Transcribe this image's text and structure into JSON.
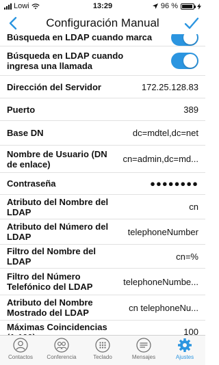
{
  "status": {
    "carrier": "Lowi",
    "time": "13:29",
    "battery_text": "96 %",
    "battery_level": 0.96
  },
  "nav": {
    "title": "Configuración Manual",
    "back_icon": "chevron-left-icon",
    "done_icon": "checkmark-icon"
  },
  "rows": [
    {
      "label": "Búsqueda en LDAP cuando marca",
      "type": "toggle",
      "on": true
    },
    {
      "label": "Búsqueda en LDAP cuando ingresa una llamada",
      "type": "toggle",
      "on": true
    },
    {
      "label": "Dirección del Servidor",
      "value": "172.25.128.83"
    },
    {
      "label": "Puerto",
      "value": "389"
    },
    {
      "label": "Base DN",
      "value": "dc=mdtel,dc=net"
    },
    {
      "label": "Nombre de Usuario (DN de enlace)",
      "value": "cn=admin,dc=md..."
    },
    {
      "label": "Contraseña",
      "value": "●●●●●●●●"
    },
    {
      "label": "Atributo del Nombre del LDAP",
      "value": "cn"
    },
    {
      "label": "Atributo del Número del LDAP",
      "value": "telephoneNumber"
    },
    {
      "label": "Filtro del Nombre del LDAP",
      "value": "cn=%"
    },
    {
      "label": "Filtro del Número Telefónico del LDAP",
      "value": "telephoneNumbe..."
    },
    {
      "label": "Atributo del Nombre Mostrado del LDAP",
      "value": "cn telephoneNu..."
    },
    {
      "label": "Máximas Coincidencias (1-100)",
      "value": "100"
    }
  ],
  "tabs": [
    {
      "label": "Contactos",
      "icon": "contacts-icon",
      "active": false
    },
    {
      "label": "Conferencia",
      "icon": "conference-icon",
      "active": false
    },
    {
      "label": "Teclado",
      "icon": "keypad-icon",
      "active": false
    },
    {
      "label": "Mensajes",
      "icon": "messages-icon",
      "active": false
    },
    {
      "label": "Ajustes",
      "icon": "settings-gear-icon",
      "active": true
    }
  ],
  "colors": {
    "accent": "#2b95e0",
    "inactive_tab": "#6b6b6b"
  }
}
